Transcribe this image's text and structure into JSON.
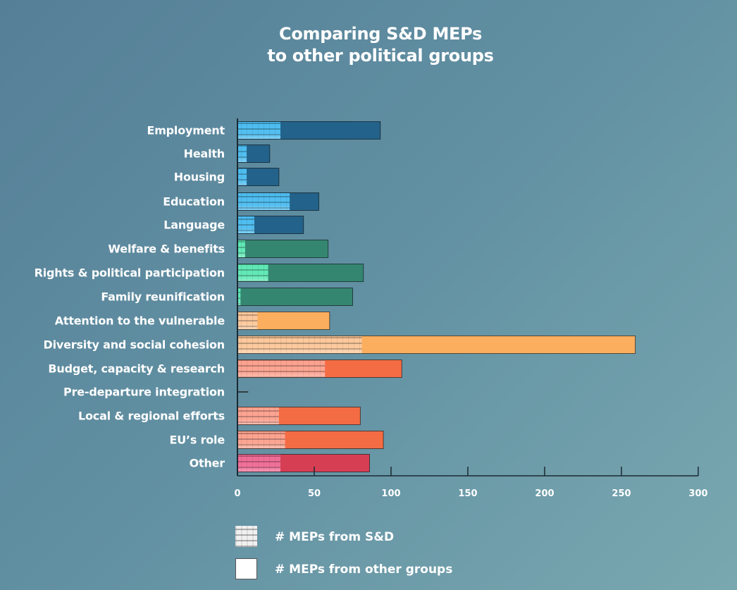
{
  "chart_data": {
    "type": "bar",
    "orientation": "horizontal",
    "stacked": true,
    "title": "Comparing S&D MEPs\nto other political groups",
    "title_lines": [
      "Comparing S&D MEPs",
      "to other political groups"
    ],
    "xlabel": "",
    "ylabel": "",
    "xlim": [
      0,
      300
    ],
    "xticks": [
      0,
      50,
      100,
      150,
      200,
      250,
      300
    ],
    "grid": false,
    "legend_position": "bottom",
    "categories": [
      "Employment",
      "Health",
      "Housing",
      "Education",
      "Language",
      "Welfare & benefits",
      "Rights & political participation",
      "Family reunification",
      "Attention to the vulnerable",
      "Diversity and social cohesion",
      "Budget, capacity & research",
      "Pre-departure integration",
      "Local & regional efforts",
      "EU’s role",
      "Other"
    ],
    "series": [
      {
        "name": "# MEPs from S&D",
        "pattern": "grid",
        "values": [
          28,
          6,
          6,
          34,
          11,
          5,
          20,
          2,
          13,
          81,
          57,
          0,
          27,
          31,
          28
        ]
      },
      {
        "name": "# MEPs from other groups",
        "pattern": "solid",
        "values": [
          65,
          15,
          21,
          19,
          32,
          54,
          62,
          73,
          47,
          178,
          50,
          7,
          53,
          64,
          58
        ]
      }
    ],
    "totals": [
      93,
      21,
      27,
      53,
      43,
      59,
      82,
      75,
      60,
      259,
      107,
      7,
      80,
      95,
      86
    ],
    "category_colors": {
      "other_groups": [
        "#23628a",
        "#23628a",
        "#23628a",
        "#23628a",
        "#23628a",
        "#348670",
        "#348670",
        "#348670",
        "#fbae5e",
        "#fbae5e",
        "#f36c44",
        "#333333",
        "#f36c44",
        "#f36c44",
        "#d63f53"
      ],
      "sd": [
        "#4bbcf0",
        "#4bbcf0",
        "#4bbcf0",
        "#4bbcf0",
        "#4bbcf0",
        "#5de8b4",
        "#5de8b4",
        "#5de8b4",
        "#fcc79a",
        "#fcc79a",
        "#fca18e",
        "#333333",
        "#fca18e",
        "#fca18e",
        "#f06a96"
      ]
    }
  },
  "legend": {
    "sd_label": "# MEPs from S&D",
    "other_label": "# MEPs from other groups"
  }
}
